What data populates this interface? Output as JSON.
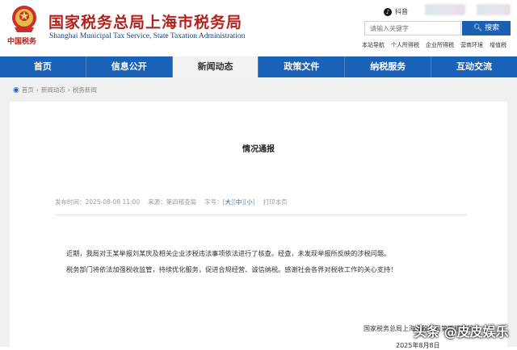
{
  "header": {
    "title_cn": "国家税务总局上海市税务局",
    "title_en": "Shanghai Municipal Tax Service, State Taxation Administration",
    "emblem_text": "中国税务",
    "douyin_label": "抖音",
    "search_placeholder": "请输入关键字",
    "search_button": "搜索",
    "quick_links": [
      "本站导航",
      "个人所得税",
      "企业所得税",
      "营商环境",
      "增值税"
    ]
  },
  "nav": {
    "items": [
      "首页",
      "信息公开",
      "新闻动态",
      "政策文件",
      "纳税服务",
      "互动交流"
    ],
    "active_index": 2
  },
  "breadcrumb": {
    "home": "首页",
    "level1": "新闻动态",
    "level2": "税务新闻"
  },
  "article": {
    "title": "情况通报",
    "publish_label": "发布时间：",
    "publish_time": "2025-08-08 11:00",
    "source_label": "来源：",
    "source": "第四稽查局",
    "font_label": "字号：",
    "font_large": "大",
    "font_medium": "中",
    "font_small": "小",
    "print_label": "打印本页",
    "paragraphs": [
      "近期，我局对王某举报刘某庆及相关企业涉税违法事项依法进行了核查。经查，未发现举报所反映的涉税问题。",
      "税务部门将依法加强税收监管，持续优化服务，促进合规经营、诚信纳税。感谢社会各界对税收工作的关心支持！"
    ],
    "signature_org": "国家税务总局上海市税务局第四稽查局",
    "signature_date": "2025年8月8日"
  },
  "watermark": {
    "text": "头条 @皮皮娱乐"
  },
  "colors": {
    "brand_red": "#b3211c",
    "nav_blue": "#1a62b8"
  }
}
